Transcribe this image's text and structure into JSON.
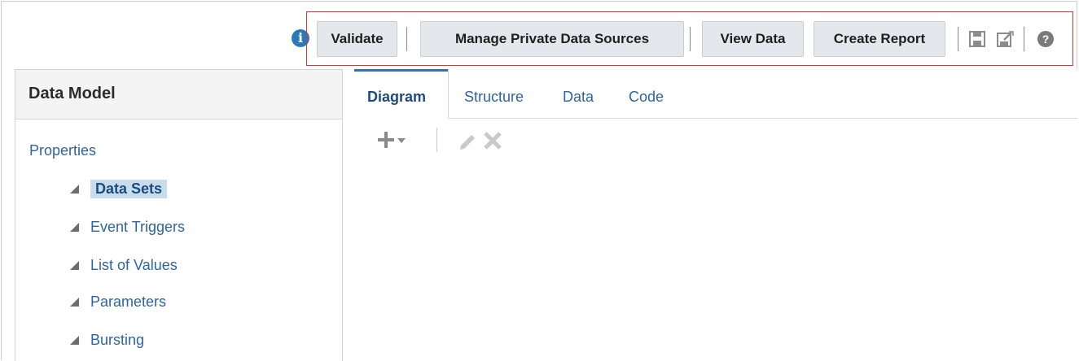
{
  "toolbar": {
    "info_icon": "i",
    "buttons": {
      "validate": "Validate",
      "manage_private": "Manage Private Data Sources",
      "view_data": "View Data",
      "create_report": "Create Report"
    },
    "icons": [
      "save-icon",
      "save-as-icon",
      "help-icon"
    ],
    "highlight_color": "#e0342f"
  },
  "left_panel": {
    "title": "Data Model",
    "properties_link": "Properties",
    "items": [
      {
        "label": "Data Sets",
        "selected": true
      },
      {
        "label": "Event Triggers",
        "selected": false
      },
      {
        "label": "List of Values",
        "selected": false
      },
      {
        "label": "Parameters",
        "selected": false
      },
      {
        "label": "Bursting",
        "selected": false
      }
    ]
  },
  "right_panel": {
    "tabs": [
      {
        "label": "Diagram",
        "active": true
      },
      {
        "label": "Structure",
        "active": false
      },
      {
        "label": "Data",
        "active": false
      },
      {
        "label": "Code",
        "active": false
      }
    ],
    "tools": [
      "add-icon",
      "dropdown-arrow-icon",
      "edit-icon",
      "delete-icon"
    ]
  },
  "colors": {
    "link": "#2d64a4",
    "accent": "#2d72b8",
    "selection": "#c8dcec"
  }
}
